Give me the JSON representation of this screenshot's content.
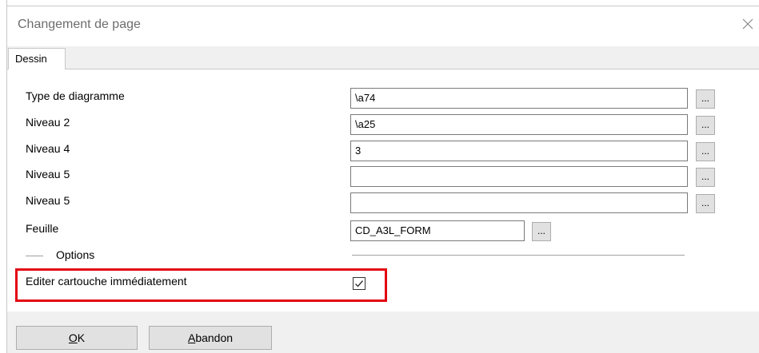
{
  "dialog": {
    "title": "Changement de page",
    "close_icon": "close-icon"
  },
  "tabs": [
    {
      "label": "Dessin",
      "active": true
    }
  ],
  "fields": [
    {
      "label": "Type de diagramme",
      "value": "\\a74"
    },
    {
      "label": "Niveau 2",
      "value": "\\a25"
    },
    {
      "label": "Niveau 4",
      "value": "3"
    },
    {
      "label": "Niveau 5",
      "value": ""
    },
    {
      "label": "Niveau 5",
      "value": ""
    }
  ],
  "sheet": {
    "label": "Feuille",
    "value": "CD_A3L_FORM"
  },
  "browse_label": "...",
  "options": {
    "group_label": "Options",
    "edit_cartouche": {
      "label": "Editer cartouche immédiatement",
      "checked": true
    }
  },
  "buttons": {
    "ok": {
      "mnemonic": "O",
      "rest": "K"
    },
    "cancel": {
      "mnemonic": "A",
      "rest": "bandon"
    }
  },
  "colors": {
    "highlight": "#e30613",
    "title_text": "#6d6d6d",
    "button_face": "#e1e1e1"
  }
}
